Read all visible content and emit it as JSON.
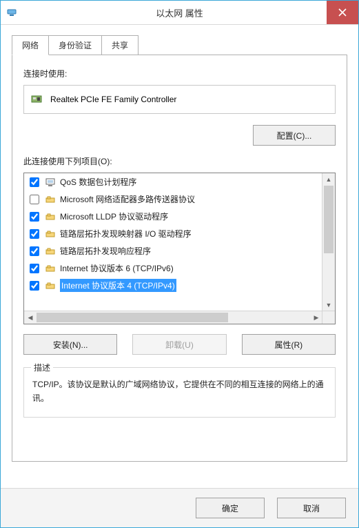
{
  "window": {
    "title": "以太网 属性"
  },
  "tabs": {
    "network": "网络",
    "auth": "身份验证",
    "sharing": "共享"
  },
  "connect_using_label": "连接时使用:",
  "adapter_name": "Realtek PCIe FE Family Controller",
  "configure_button": "配置(C)...",
  "items_label": "此连接使用下列项目(O):",
  "items": [
    {
      "checked": true,
      "selected": false,
      "icon": "service",
      "label": "QoS 数据包计划程序"
    },
    {
      "checked": false,
      "selected": false,
      "icon": "proto",
      "label": "Microsoft 网络适配器多路传送器协议"
    },
    {
      "checked": true,
      "selected": false,
      "icon": "proto",
      "label": "Microsoft LLDP 协议驱动程序"
    },
    {
      "checked": true,
      "selected": false,
      "icon": "proto",
      "label": "链路层拓扑发现映射器 I/O 驱动程序"
    },
    {
      "checked": true,
      "selected": false,
      "icon": "proto",
      "label": "链路层拓扑发现响应程序"
    },
    {
      "checked": true,
      "selected": false,
      "icon": "proto",
      "label": "Internet 协议版本 6 (TCP/IPv6)"
    },
    {
      "checked": true,
      "selected": true,
      "icon": "proto",
      "label": "Internet 协议版本 4 (TCP/IPv4)"
    }
  ],
  "install_button": "安装(N)...",
  "uninstall_button": "卸载(U)",
  "properties_button": "属性(R)",
  "description_legend": "描述",
  "description_text": "TCP/IP。该协议是默认的广域网络协议，它提供在不同的相互连接的网络上的通讯。",
  "ok_button": "确定",
  "cancel_button": "取消"
}
